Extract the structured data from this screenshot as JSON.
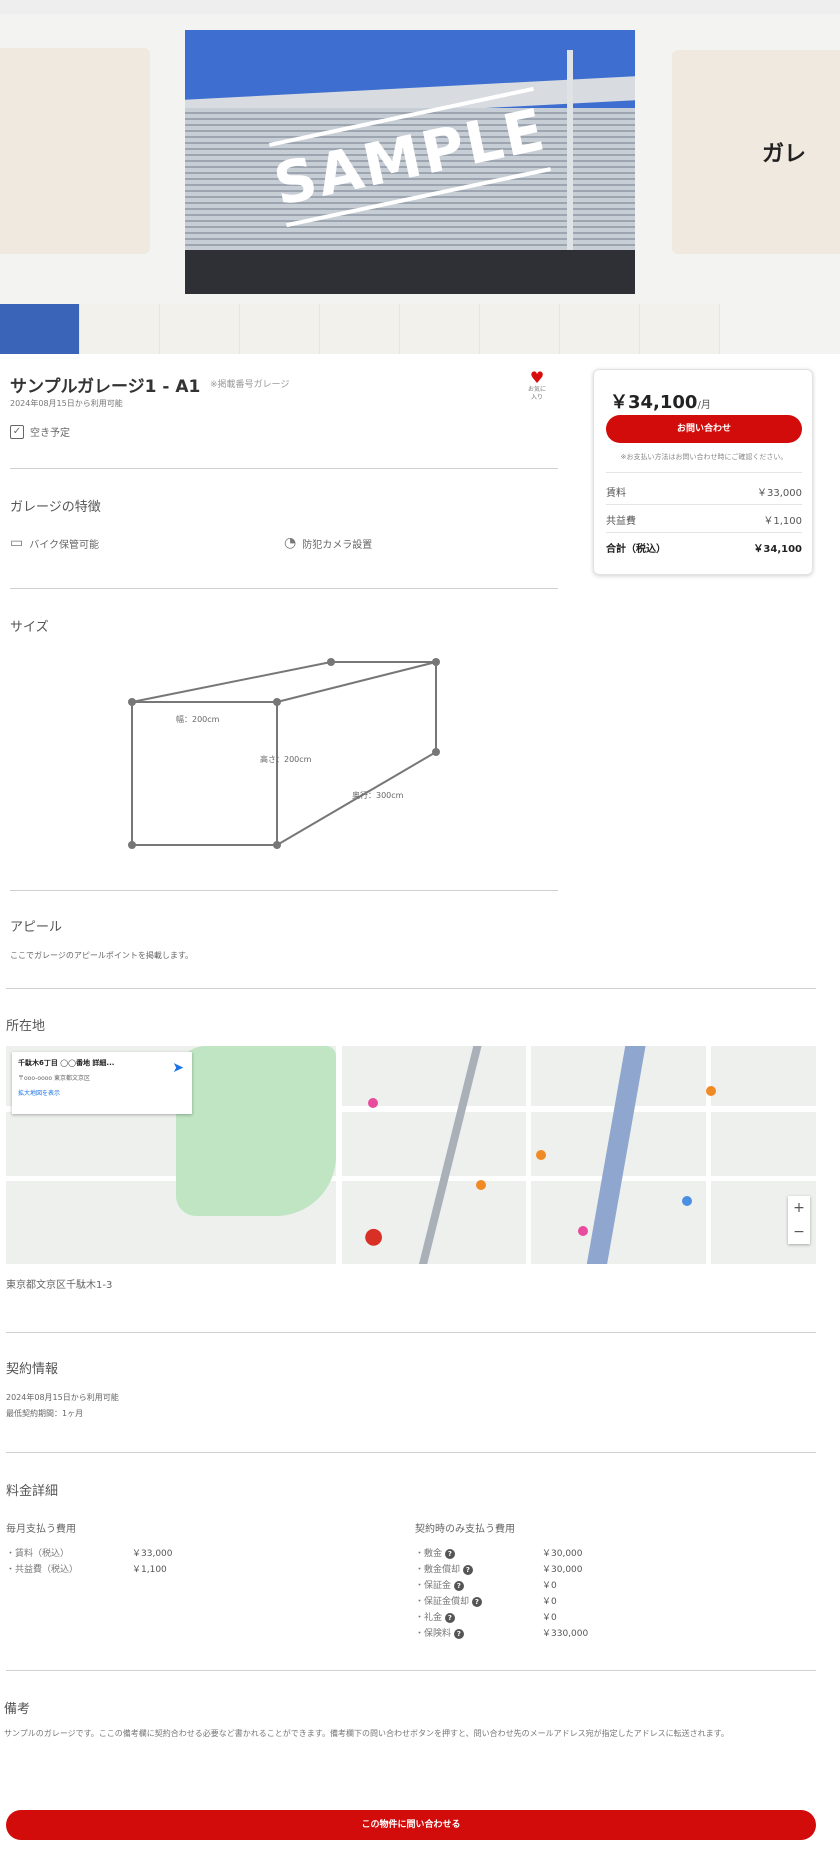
{
  "carousel": {
    "sample_text": "SAMPLE",
    "right_card_text": "ガレ"
  },
  "listing": {
    "title": "サンプルガレージ1 - A1",
    "title_sub": "※掲載番号ガレージ",
    "date": "2024年08月15日から利用可能",
    "checkbox_label": "空き予定",
    "favorite_label": "お気に入り"
  },
  "features": {
    "title": "ガレージの特徴",
    "items": [
      {
        "icon": "bike-icon",
        "label": "バイク保管可能"
      },
      {
        "icon": "camera-icon",
        "label": "防犯カメラ設置"
      }
    ]
  },
  "size": {
    "title": "サイズ",
    "width_label": "幅：200cm",
    "height_label": "高さ：200cm",
    "depth_label": "奥行：300cm"
  },
  "appeal": {
    "title": "アピール",
    "text": "ここでガレージのアピールポイントを掲載します。"
  },
  "price_card": {
    "price": "￥34,100",
    "unit": "/月",
    "contact_label": "お問い合わせ",
    "note": "※お支払い方法はお問い合わせ時にご確認ください。",
    "rows": [
      {
        "label": "賃料",
        "value": "￥33,000"
      },
      {
        "label": "共益費",
        "value": "￥1,100"
      }
    ],
    "total_label": "合計（税込）",
    "total_value": "￥34,100"
  },
  "location": {
    "title": "所在地",
    "popup_title": "千駄木6丁目 ◯◯番地 詳細...",
    "popup_address": "〒ooo-oooo 東京都文京区",
    "popup_link": "拡大地図を表示",
    "address": "東京都文京区千駄木1-3",
    "zoom_in": "+",
    "zoom_out": "−"
  },
  "contract": {
    "title": "契約情報",
    "line1": "2024年08月15日から利用可能",
    "line2": "最低契約期間：1ヶ月"
  },
  "fees": {
    "title": "料金詳細",
    "monthly": {
      "title": "毎月支払う費用",
      "rows": [
        {
          "label": "・賃料（税込）",
          "value": "￥33,000"
        },
        {
          "label": "・共益費（税込）",
          "value": "￥1,100"
        }
      ]
    },
    "initial": {
      "title": "契約時のみ支払う費用",
      "rows": [
        {
          "label": "・敷金",
          "value": "￥30,000"
        },
        {
          "label": "・敷金償却",
          "value": "￥30,000"
        },
        {
          "label": "・保証金",
          "value": "￥0"
        },
        {
          "label": "・保証金償却",
          "value": "￥0"
        },
        {
          "label": "・礼金",
          "value": "￥0"
        },
        {
          "label": "・保険料",
          "value": "￥330,000"
        }
      ]
    }
  },
  "remarks": {
    "title": "備考",
    "text": "サンプルのガレージです。ここの備考欄に契約合わせる必要など書かれることができます。備考欄下の問い合わせボタンを押すと、問い合わせ先のメールアドレス宛が指定したアドレスに転送されます。"
  },
  "bottom_button": "この物件に問い合わせる",
  "colors": {
    "accent": "#d20b0b",
    "link": "#1a73e8"
  }
}
